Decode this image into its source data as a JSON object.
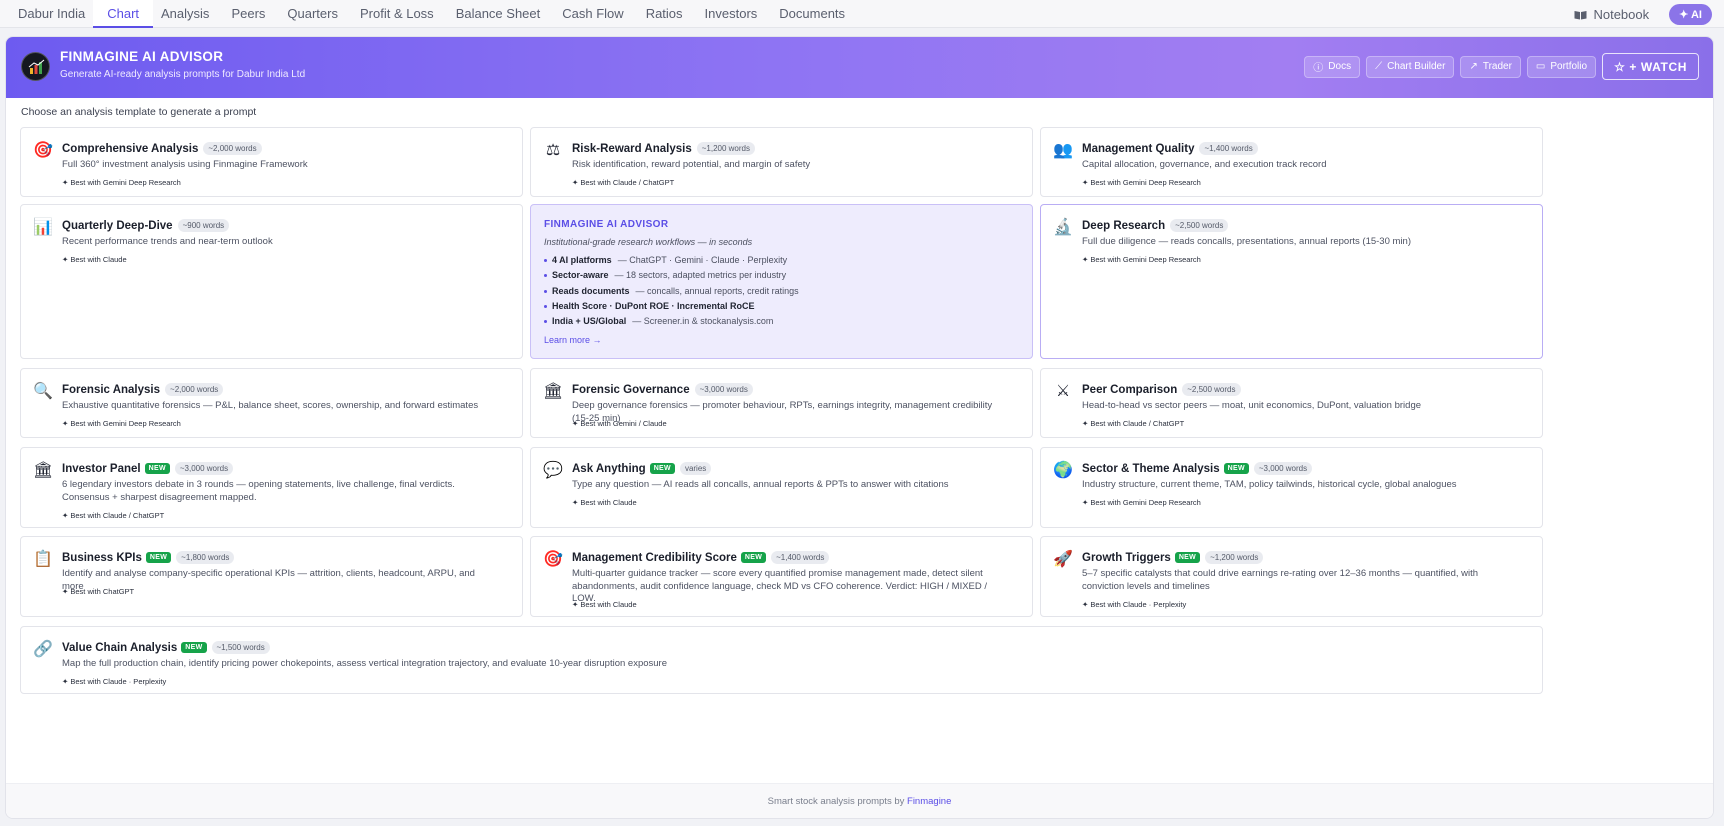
{
  "nav": {
    "tabs": [
      "Dabur India",
      "Chart",
      "Analysis",
      "Peers",
      "Quarters",
      "Profit & Loss",
      "Balance Sheet",
      "Cash Flow",
      "Ratios",
      "Investors",
      "Documents"
    ],
    "active_tab": "Chart",
    "notebook": "Notebook",
    "ai": "✦ AI"
  },
  "hero": {
    "title": "FINMAGINE AI ADVISOR",
    "subtitle": "Generate AI-ready analysis prompts for Dabur India Ltd",
    "buttons": [
      {
        "label": "Docs",
        "icon": "ⓘ"
      },
      {
        "label": "Chart Builder",
        "icon": "⟋"
      },
      {
        "label": "Trader",
        "icon": "↗"
      },
      {
        "label": "Portfolio",
        "icon": "▭"
      }
    ],
    "watch": "☆ + WATCH"
  },
  "choose_label": "Choose an analysis template to generate a prompt",
  "cards": [
    {
      "icon": "🎯",
      "title": "Comprehensive Analysis",
      "isNew": false,
      "words": "~2,000 words",
      "desc": "Full 360° investment analysis using Finmagine Framework",
      "best": "✦ Best with Gemini Deep Research"
    },
    {
      "icon": "⚖",
      "title": "Risk-Reward Analysis",
      "isNew": false,
      "words": "~1,200 words",
      "desc": "Risk identification, reward potential, and margin of safety",
      "best": "✦ Best with Claude / ChatGPT"
    },
    {
      "icon": "👥",
      "title": "Management Quality",
      "isNew": false,
      "words": "~1,400 words",
      "desc": "Capital allocation, governance, and execution track record",
      "best": "✦ Best with Gemini Deep Research"
    },
    {
      "icon": "📊",
      "title": "Quarterly Deep-Dive",
      "isNew": false,
      "words": "~900 words",
      "desc": "Recent performance trends and near-term outlook",
      "best": "✦ Best with Claude"
    },
    {
      "icon": "🔬",
      "title": "Deep Research",
      "isNew": false,
      "words": "~2,500 words",
      "desc": "Full due diligence — reads concalls, presentations, annual reports (15-30 min)",
      "best": "✦ Best with Gemini Deep Research"
    },
    {
      "icon": "🔍",
      "title": "Forensic Analysis",
      "isNew": false,
      "words": "~2,000 words",
      "desc": "Exhaustive quantitative forensics — P&L, balance sheet, scores, ownership, and forward estimates",
      "best": "✦ Best with Gemini Deep Research"
    },
    {
      "icon": "🏛",
      "title": "Forensic Governance",
      "isNew": false,
      "words": "~3,000 words",
      "desc": "Deep governance forensics — promoter behaviour, RPTs, earnings integrity, management credibility (15-25 min)",
      "best": "✦ Best with Gemini / Claude"
    },
    {
      "icon": "⚔",
      "title": "Peer Comparison",
      "isNew": false,
      "words": "~2,500 words",
      "desc": "Head-to-head vs sector peers — moat, unit economics, DuPont, valuation bridge",
      "best": "✦ Best with Claude / ChatGPT"
    },
    {
      "icon": "🏛",
      "title": "Investor Panel",
      "isNew": true,
      "words": "~3,000 words",
      "desc": "6 legendary investors debate in 3 rounds — opening statements, live challenge, final verdicts. Consensus + sharpest disagreement mapped.",
      "best": "✦ Best with Claude / ChatGPT"
    },
    {
      "icon": "💬",
      "title": "Ask Anything",
      "isNew": true,
      "words": "varies",
      "desc": "Type any question — AI reads all concalls, annual reports & PPTs to answer with citations",
      "best": "✦ Best with Claude"
    },
    {
      "icon": "🌍",
      "title": "Sector & Theme Analysis",
      "isNew": true,
      "words": "~3,000 words",
      "desc": "Industry structure, current theme, TAM, policy tailwinds, historical cycle, global analogues",
      "best": "✦ Best with Gemini Deep Research"
    },
    {
      "icon": "📋",
      "title": "Business KPIs",
      "isNew": true,
      "words": "~1,800 words",
      "desc": "Identify and analyse company-specific operational KPIs — attrition, clients, headcount, ARPU, and more",
      "best": "✦ Best with ChatGPT"
    },
    {
      "icon": "🎯",
      "title": "Management Credibility Score",
      "isNew": true,
      "words": "~1,400 words",
      "desc": "Multi-quarter guidance tracker — score every quantified promise management made, detect silent abandonments, audit confidence language, check MD vs CFO coherence. Verdict: HIGH / MIXED / LOW.",
      "best": "✦ Best with Claude"
    },
    {
      "icon": "🚀",
      "title": "Growth Triggers",
      "isNew": true,
      "words": "~1,200 words",
      "desc": "5–7 specific catalysts that could drive earnings re-rating over 12–36 months — quantified, with conviction levels and timelines",
      "best": "✦ Best with Claude · Perplexity"
    },
    {
      "icon": "🔗",
      "title": "Value Chain Analysis",
      "isNew": true,
      "words": "~1,500 words",
      "desc": "Map the full production chain, identify pricing power chokepoints, assess vertical integration trajectory, and evaluate 10-year disruption exposure",
      "best": "✦ Best with Claude · Perplexity"
    }
  ],
  "new_label": "NEW",
  "feature": {
    "title": "FINMAGINE AI ADVISOR",
    "tagline": "Institutional-grade research workflows — in seconds",
    "items": [
      {
        "bold": "4 AI platforms",
        "text": "— ChatGPT · Gemini · Claude · Perplexity"
      },
      {
        "bold": "Sector-aware",
        "text": "— 18 sectors, adapted metrics per industry"
      },
      {
        "bold": "Reads documents",
        "text": "— concalls, annual reports, credit ratings"
      },
      {
        "bold": "Health Score · DuPont ROE · Incremental RoCE",
        "text": ""
      },
      {
        "bold": "India + US/Global",
        "text": "— Screener.in & stockanalysis.com"
      }
    ],
    "learn_more": "Learn more →"
  },
  "footer": {
    "text": "Smart stock analysis prompts by ",
    "link": "Finmagine"
  }
}
